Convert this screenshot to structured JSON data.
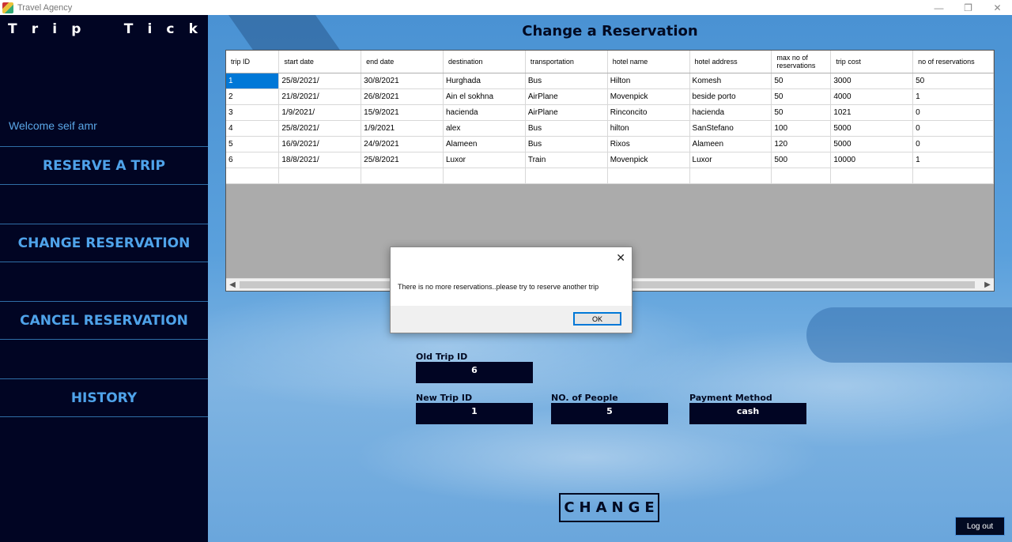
{
  "window": {
    "title": "Travel Agency",
    "controls": [
      "—",
      "❐",
      "✕"
    ]
  },
  "sidebar": {
    "brand_letters": [
      "T",
      "r",
      "i",
      "p",
      "T",
      "i",
      "c",
      "k"
    ],
    "welcome": "Welcome seif amr",
    "nav": [
      "RESERVE A TRIP",
      "CHANGE RESERVATION",
      "CANCEL RESERVATION",
      "HISTORY"
    ]
  },
  "main": {
    "title": "Change a Reservation",
    "grid": {
      "columns": [
        "trip ID",
        "start date",
        "end date",
        "destination",
        "transportation",
        "hotel name",
        "hotel address",
        "max no of reservations",
        "trip cost",
        "no of reservations"
      ],
      "rows": [
        [
          "1",
          "25/8/2021/",
          "30/8/2021",
          "Hurghada",
          "Bus",
          "Hilton",
          "Komesh",
          "50",
          "3000",
          "50"
        ],
        [
          "2",
          "21/8/2021/",
          "26/8/2021",
          "Ain el sokhna",
          "AirPlane",
          "Movenpick",
          "beside porto",
          "50",
          "4000",
          "1"
        ],
        [
          "3",
          "1/9/2021/",
          "15/9/2021",
          "hacienda",
          "AirPlane",
          "Rinconcito",
          "hacienda",
          "50",
          "1021",
          "0"
        ],
        [
          "4",
          "25/8/2021/",
          "1/9/2021",
          "alex",
          "Bus",
          "hilton",
          "SanStefano",
          "100",
          "5000",
          "0"
        ],
        [
          "5",
          "16/9/2021/",
          "24/9/2021",
          "Alameen",
          "Bus",
          "Rixos",
          "Alameen",
          "120",
          "5000",
          "0"
        ],
        [
          "6",
          "18/8/2021/",
          "25/8/2021",
          "Luxor",
          "Train",
          "Movenpick",
          "Luxor",
          "500",
          "10000",
          "1"
        ]
      ]
    },
    "old_trip_label": "Old Trip ID",
    "old_trip_value": "6",
    "new_trip_label": "New Trip ID",
    "new_trip_value": "1",
    "people_label": "NO. of People",
    "people_value": "5",
    "payment_label": "Payment Method",
    "payment_value": "cash",
    "change_button": "CHANGE",
    "logout_button": "Log out"
  },
  "dialog": {
    "message": "There is no more reservations..please try to reserve another trip",
    "ok_label": "OK",
    "close_glyph": "✕"
  }
}
